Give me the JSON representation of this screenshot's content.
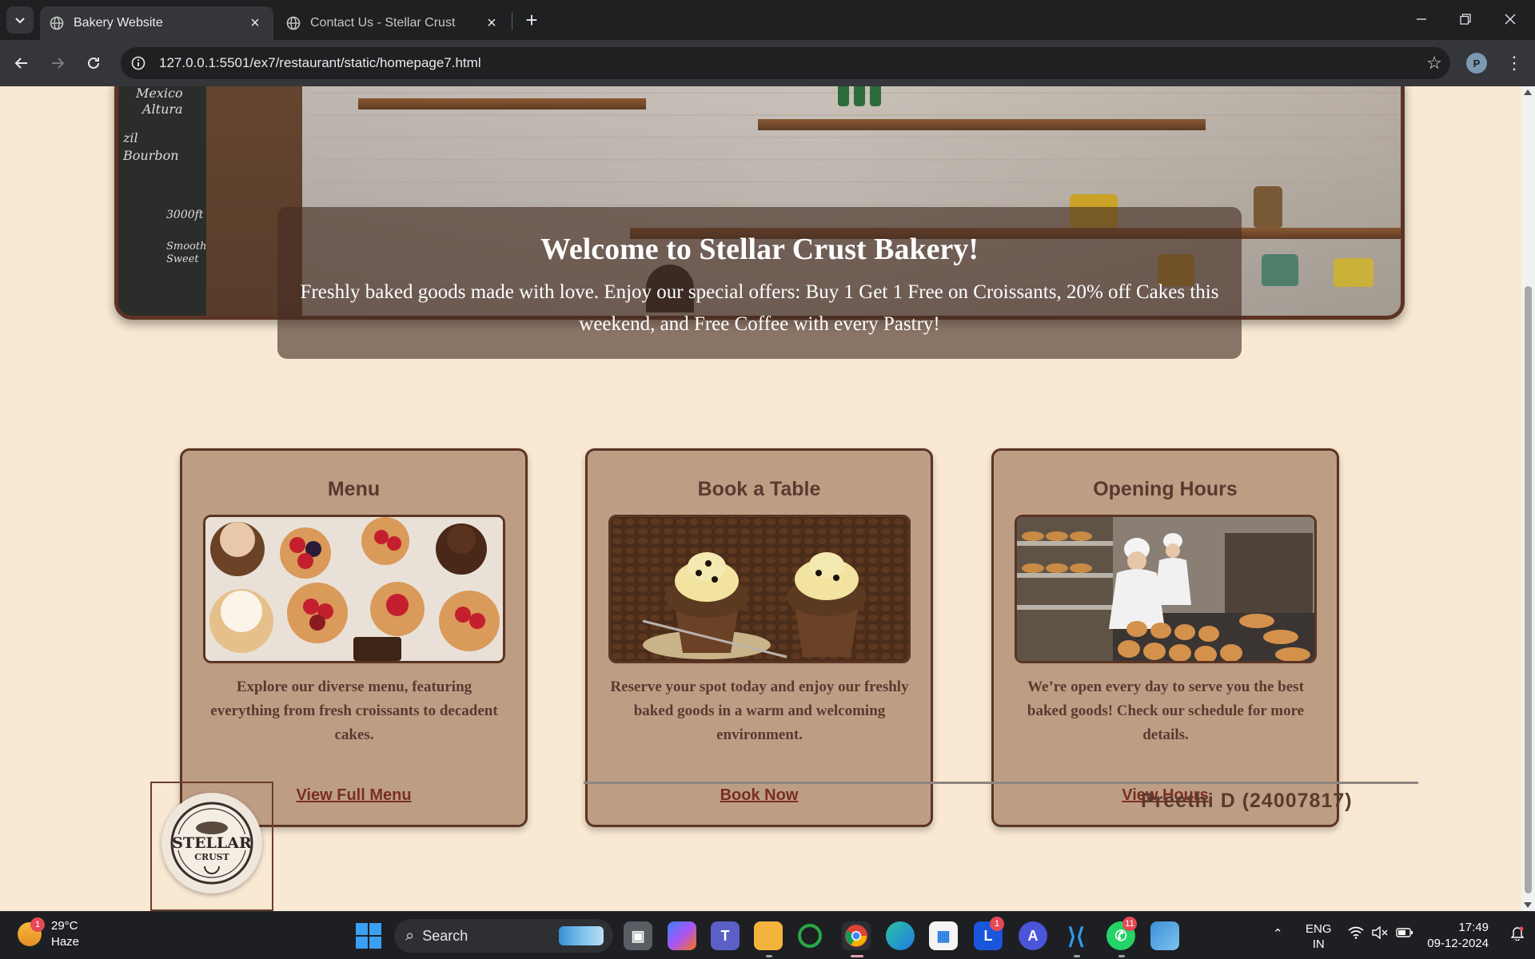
{
  "browser": {
    "tabs": [
      {
        "title": "Bakery Website",
        "active": true
      },
      {
        "title": "Contact Us - Stellar Crust",
        "active": false
      }
    ],
    "url": "127.0.0.1:5501/ex7/restaurant/static/homepage7.html",
    "profile_initial": "P"
  },
  "hero": {
    "title": "Welcome to Stellar Crust Bakery!",
    "text": "Freshly baked goods made with love. Enjoy our special offers: Buy 1 Get 1 Free on Croissants, 20% off Cakes this weekend, and Free Coffee with every Pastry!"
  },
  "cards": [
    {
      "title": "Menu",
      "text": "Explore our diverse menu, featuring everything from fresh croissants to decadent cakes.",
      "link": "View Full Menu"
    },
    {
      "title": "Book a Table",
      "text": "Reserve your spot today and enjoy our freshly baked goods in a warm and welcoming environment.",
      "link": "Book Now"
    },
    {
      "title": "Opening Hours",
      "text": "We’re open every day to serve you the best baked goods! Check our schedule for more details.",
      "link": "View Hours"
    }
  ],
  "footer": {
    "name": "Preethi D (24007817)",
    "logo_top": "STELLAR",
    "logo_bottom": "CRUST"
  },
  "taskbar": {
    "weather_temp": "29°C",
    "weather_desc": "Haze",
    "weather_badge": "1",
    "search_label": "Search",
    "lang_top": "ENG",
    "lang_bottom": "IN",
    "time": "17:49",
    "date": "09-12-2024",
    "badge_l": "1",
    "badge_whatsapp": "11"
  },
  "colors": {
    "page_bg": "#f9e8d2",
    "card_bg": "#bd9e85",
    "border_brown": "#5b3424",
    "link": "#7a2e22"
  }
}
